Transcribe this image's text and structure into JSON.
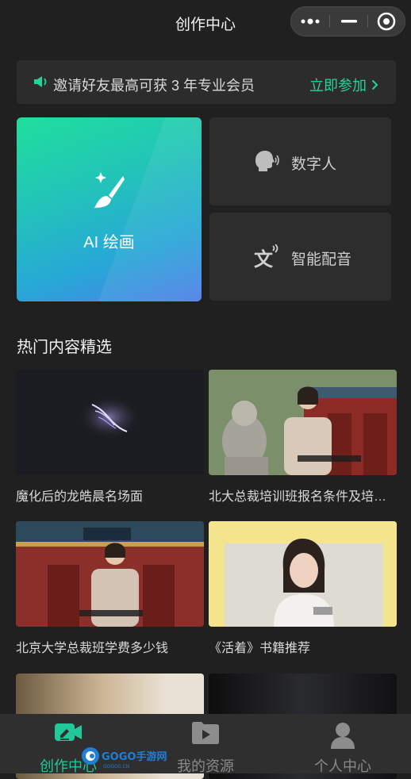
{
  "header": {
    "title": "创作中心"
  },
  "banner": {
    "text": "邀请好友最高可获 3 年专业会员",
    "cta": "立即参加",
    "accent": "#27d29a"
  },
  "features": {
    "ai_paint": {
      "label": "AI 绘画"
    },
    "digital_human": {
      "label": "数字人"
    },
    "voice": {
      "label": "智能配音"
    }
  },
  "section": {
    "title": "热门内容精选"
  },
  "items": [
    {
      "caption": "魔化后的龙皓晨名场面"
    },
    {
      "caption": "北大总裁培训班报名条件及培训费用"
    },
    {
      "caption": "北京大学总裁班学费多少钱"
    },
    {
      "caption": "《活着》书籍推荐"
    },
    {
      "caption": ""
    },
    {
      "caption": ""
    }
  ],
  "tabs": [
    {
      "label": "创作中心",
      "icon": "pen-camera-icon",
      "active": true
    },
    {
      "label": "我的资源",
      "icon": "folder-play-icon",
      "active": false
    },
    {
      "label": "个人中心",
      "icon": "person-icon",
      "active": false
    }
  ],
  "watermark": {
    "text": "GOGO手游网",
    "sub": "GOGO0.CN"
  }
}
